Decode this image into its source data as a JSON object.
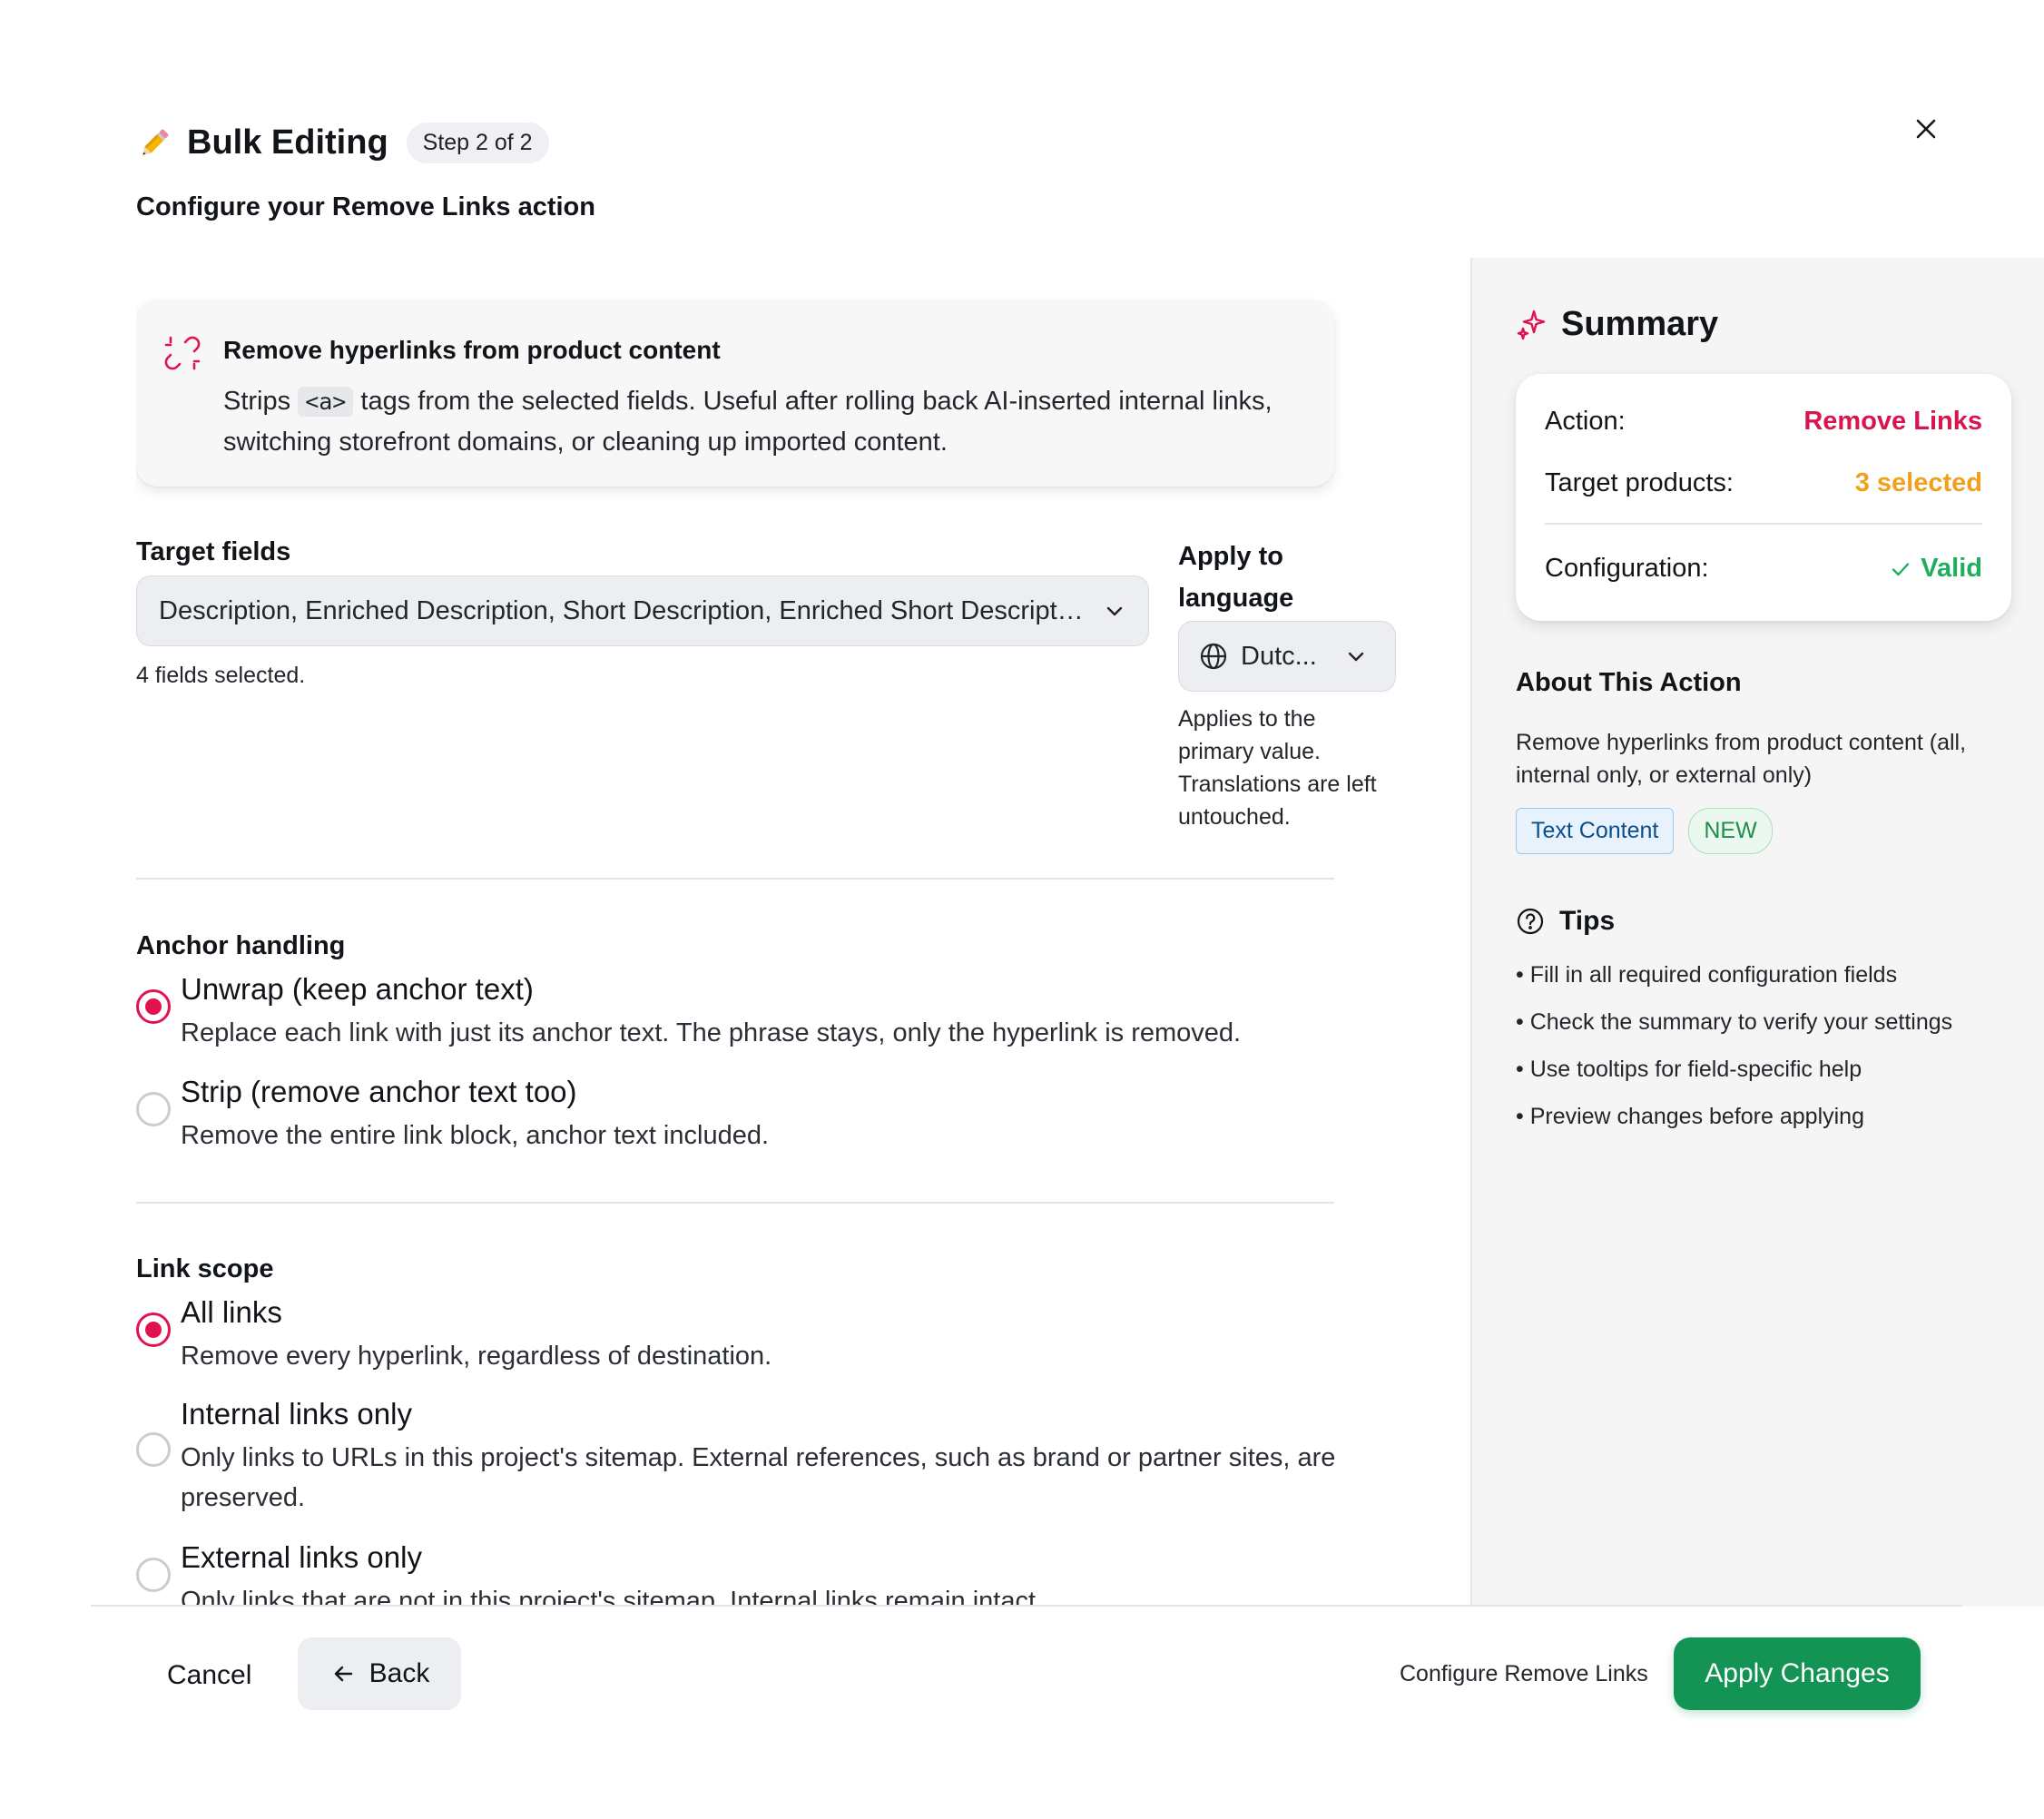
{
  "header": {
    "title": "Bulk Editing",
    "step": "Step 2 of 2",
    "subtitle_prefix": "Configure your ",
    "subtitle_action": "Remove Links",
    "subtitle_suffix": " action"
  },
  "info": {
    "title": "Remove hyperlinks from product content",
    "desc_before": "Strips ",
    "desc_code": "<a>",
    "desc_after": " tags from the selected fields. Useful after rolling back AI-inserted internal links, switching storefront domains, or cleaning up imported content."
  },
  "target_fields": {
    "label": "Target fields",
    "value": "Description, Enriched Description, Short Description, Enriched Short Description",
    "help": "4 fields selected."
  },
  "language": {
    "label": "Apply to language",
    "value": "Dutc...",
    "help": "Applies to the primary value. Translations are left untouched."
  },
  "anchor_handling": {
    "label": "Anchor handling",
    "options": [
      {
        "title": "Unwrap (keep anchor text)",
        "desc": "Replace each link with just its anchor text. The phrase stays, only the hyperlink is removed.",
        "checked": true
      },
      {
        "title": "Strip (remove anchor text too)",
        "desc": "Remove the entire link block, anchor text included.",
        "checked": false
      }
    ]
  },
  "link_scope": {
    "label": "Link scope",
    "options": [
      {
        "title": "All links",
        "desc": "Remove every hyperlink, regardless of destination.",
        "checked": true
      },
      {
        "title": "Internal links only",
        "desc": "Only links to URLs in this project's sitemap. External references, such as brand or partner sites, are preserved.",
        "checked": false
      },
      {
        "title": "External links only",
        "desc": "Only links that are not in this project's sitemap. Internal links remain intact.",
        "checked": false
      }
    ]
  },
  "summary": {
    "title": "Summary",
    "action_key": "Action:",
    "action_val": "Remove Links",
    "target_key": "Target products:",
    "target_val": "3 selected",
    "config_key": "Configuration:",
    "config_val": "Valid"
  },
  "about": {
    "title": "About This Action",
    "desc": "Remove hyperlinks from product content (all, internal only, or external only)",
    "badge_category": "Text Content",
    "badge_new": "NEW"
  },
  "tips": {
    "title": "Tips",
    "items": [
      "• Fill in all required configuration fields",
      "• Check the summary to verify your settings",
      "• Use tooltips for field-specific help",
      "• Preview changes before applying"
    ]
  },
  "footer": {
    "cancel": "Cancel",
    "back": "Back",
    "config_label": "Configure Remove Links",
    "apply": "Apply Changes"
  },
  "colors": {
    "accent_red": "#e0134f",
    "apply_green": "#139454",
    "target_orange": "#f0a01c",
    "valid_green": "#1fae5d"
  },
  "icons": {
    "title": "pencil-icon",
    "close": "close-icon",
    "info": "unlink-icon",
    "select": "chevron-down-icon",
    "language": "globe-icon",
    "summary": "sparkle-icon",
    "valid": "check-icon",
    "tips": "question-circle-icon",
    "back": "arrow-left-icon"
  }
}
